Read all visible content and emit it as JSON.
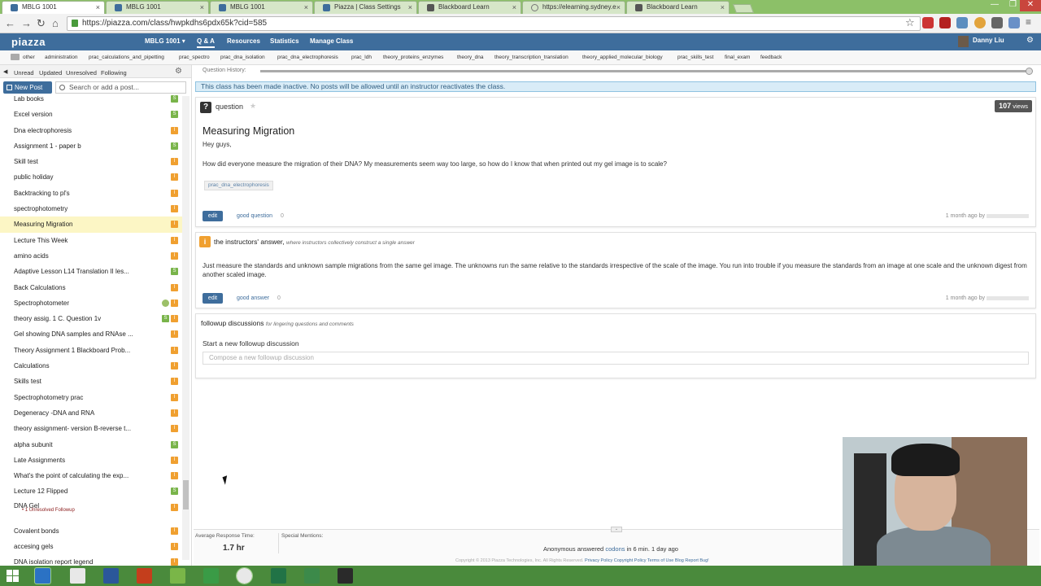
{
  "browser": {
    "tabs": [
      {
        "label": "MBLG 1001",
        "active": true,
        "icon": "piazza-icon"
      },
      {
        "label": "MBLG 1001",
        "active": false,
        "icon": "piazza-icon"
      },
      {
        "label": "MBLG 1001",
        "active": false,
        "icon": "piazza-icon"
      },
      {
        "label": "Piazza | Class Settings",
        "active": false,
        "icon": "piazza-icon"
      },
      {
        "label": "Blackboard Learn",
        "active": false,
        "icon": "blackboard-icon"
      },
      {
        "label": "https://elearning.sydney.e",
        "active": false,
        "icon": "globe-icon"
      },
      {
        "label": "Blackboard Learn",
        "active": false,
        "icon": "blackboard-icon"
      }
    ],
    "tab_close": "×",
    "url": "https://piazza.com/class/hwpkdhs6pdx65k?cid=585",
    "back": "←",
    "forward": "→",
    "reload": "↻",
    "home": "⌂",
    "bookmark_star": "☆"
  },
  "topnav": {
    "logo": "piazza",
    "class_menu": "MBLG 1001 ▾",
    "qa": "Q & A",
    "resources": "Resources",
    "statistics": "Statistics",
    "manage": "Manage Class",
    "user": "Danny Liu",
    "gear": "⚙"
  },
  "folders": [
    "other",
    "administration",
    "prac_calculations_and_pipetting",
    "prac_spectro",
    "prac_dna_isolation",
    "prac_dna_electrophoresis",
    "prac_ldh",
    "theory_proteins_enzymes",
    "theory_dna",
    "theory_transcription_translation",
    "theory_applied_molecular_biology",
    "prac_skills_test",
    "final_exam",
    "feedback"
  ],
  "sidebar": {
    "collapse_arrow": "◀",
    "filters": [
      "Unread",
      "Updated",
      "Unresolved",
      "Following"
    ],
    "gear": "⚙",
    "new_post": "New Post",
    "search_placeholder": "Search or add a post...",
    "items": [
      {
        "label": "Lab books",
        "badge": "S",
        "badge_type": "s"
      },
      {
        "label": "Excel version",
        "badge": "S",
        "badge_type": "s"
      },
      {
        "label": "Dna electrophoresis",
        "badge": "I",
        "badge_type": "i"
      },
      {
        "label": "Assignment 1 - paper b",
        "badge": "S",
        "badge_type": "s"
      },
      {
        "label": "Skill test",
        "badge": "I",
        "badge_type": "i"
      },
      {
        "label": "public holiday",
        "badge": "I",
        "badge_type": "i"
      },
      {
        "label": "Backtracking to pl's",
        "badge": "I",
        "badge_type": "i"
      },
      {
        "label": "spectrophotometry",
        "badge": "I",
        "badge_type": "i"
      },
      {
        "label": "Measuring Migration",
        "badge": "I",
        "badge_type": "i",
        "selected": true
      },
      {
        "label": "Lecture This Week",
        "badge": "I",
        "badge_type": "i"
      },
      {
        "label": "amino acids",
        "badge": "I",
        "badge_type": "i"
      },
      {
        "label": "Adaptive Lesson L14 Translation II les...",
        "badge": "S",
        "badge_type": "s"
      },
      {
        "label": "Back Calculations",
        "badge": "I",
        "badge_type": "i"
      },
      {
        "label": "Spectrophotometer",
        "badge": "I",
        "badge_type": "i",
        "extra": "g"
      },
      {
        "label": "theory assig. 1 C. Question 1v",
        "badge": "I",
        "badge_type": "i",
        "extra": "S"
      },
      {
        "label": "Gel showing DNA samples and RNAse ...",
        "badge": "I",
        "badge_type": "i"
      },
      {
        "label": "Theory Assignment 1 Blackboard Prob...",
        "badge": "I",
        "badge_type": "i"
      },
      {
        "label": "Calculations",
        "badge": "I",
        "badge_type": "i"
      },
      {
        "label": "Skills test",
        "badge": "I",
        "badge_type": "i"
      },
      {
        "label": "Spectrophotometry prac",
        "badge": "I",
        "badge_type": "i"
      },
      {
        "label": "Degeneracy -DNA and RNA",
        "badge": "I",
        "badge_type": "i"
      },
      {
        "label": "theory assignment- version B-reverse t...",
        "badge": "I",
        "badge_type": "i"
      },
      {
        "label": "alpha subunit",
        "badge": "S",
        "badge_type": "s"
      },
      {
        "label": "Late Assignments",
        "badge": "I",
        "badge_type": "i"
      },
      {
        "label": "What's the point of calculating the exp...",
        "badge": "I",
        "badge_type": "i"
      },
      {
        "label": "Lecture 12 Flipped",
        "badge": "S",
        "badge_type": "s"
      },
      {
        "label": "DNA Gel",
        "badge": "I",
        "badge_type": "i",
        "sub": "• 1 Unresolved Followup"
      },
      {
        "label": "Covalent bonds",
        "badge": "I",
        "badge_type": "i"
      },
      {
        "label": "accesing gels",
        "badge": "I",
        "badge_type": "i"
      },
      {
        "label": "DNA isolation report legend",
        "badge": "I",
        "badge_type": "i"
      }
    ]
  },
  "main": {
    "question_history": "Question History:",
    "notice": "This class has been made inactive. No posts will be allowed until an instructor reactivates the class.",
    "question": {
      "icon": "?",
      "label": "question",
      "star": "★",
      "views_count": "107",
      "views_label": "views",
      "title": "Measuring Migration",
      "greeting": "Hey guys,",
      "body": "How did everyone measure the migration of their DNA? My measurements seem way too large, so how do I know that when printed out my gel image is to scale?",
      "tag": "prac_dna_electrophoresis",
      "edit": "edit",
      "good": "good question",
      "good_count": "0",
      "meta": "1 month ago by"
    },
    "answer": {
      "icon": "i",
      "title": "the instructors' answer,",
      "subtitle": "where instructors collectively construct a single answer",
      "body": "Just measure the standards and unknown sample migrations from the same gel image. The unknowns run the same relative to the standards irrespective of the scale of the image. You run into trouble if you measure the standards from an image at one scale and the unknown digest from another scaled image.",
      "edit": "edit",
      "good": "good answer",
      "good_count": "0",
      "meta": "1 month ago by"
    },
    "followup": {
      "title": "followup discussions",
      "subtitle": "for lingering questions and comments",
      "start": "Start a new followup discussion",
      "placeholder": "Compose a new followup discussion"
    }
  },
  "stats": {
    "avg_label": "Average Response Time:",
    "avg_value": "1.7 hr",
    "special_label": "Special Mentions:",
    "anon_prefix": "Anonymous answered",
    "anon_link": "codons",
    "anon_suffix": "in 6 min. 1 day ago",
    "copyright": "Copyright © 2013 Piazza Technologies, Inc. All Rights Reserved.",
    "footer_links": "Privacy Policy   Copyright Policy   Terms of Use   Blog   Report Bug!",
    "chevron": "⌄"
  },
  "colors": {
    "piazza_blue": "#3e6d9c",
    "tab_green": "#8cc068",
    "taskbar_green": "#4a8a3c",
    "instructor_orange": "#f0a030",
    "student_green": "#79b44a",
    "selected_yellow": "#fcf6c5"
  }
}
